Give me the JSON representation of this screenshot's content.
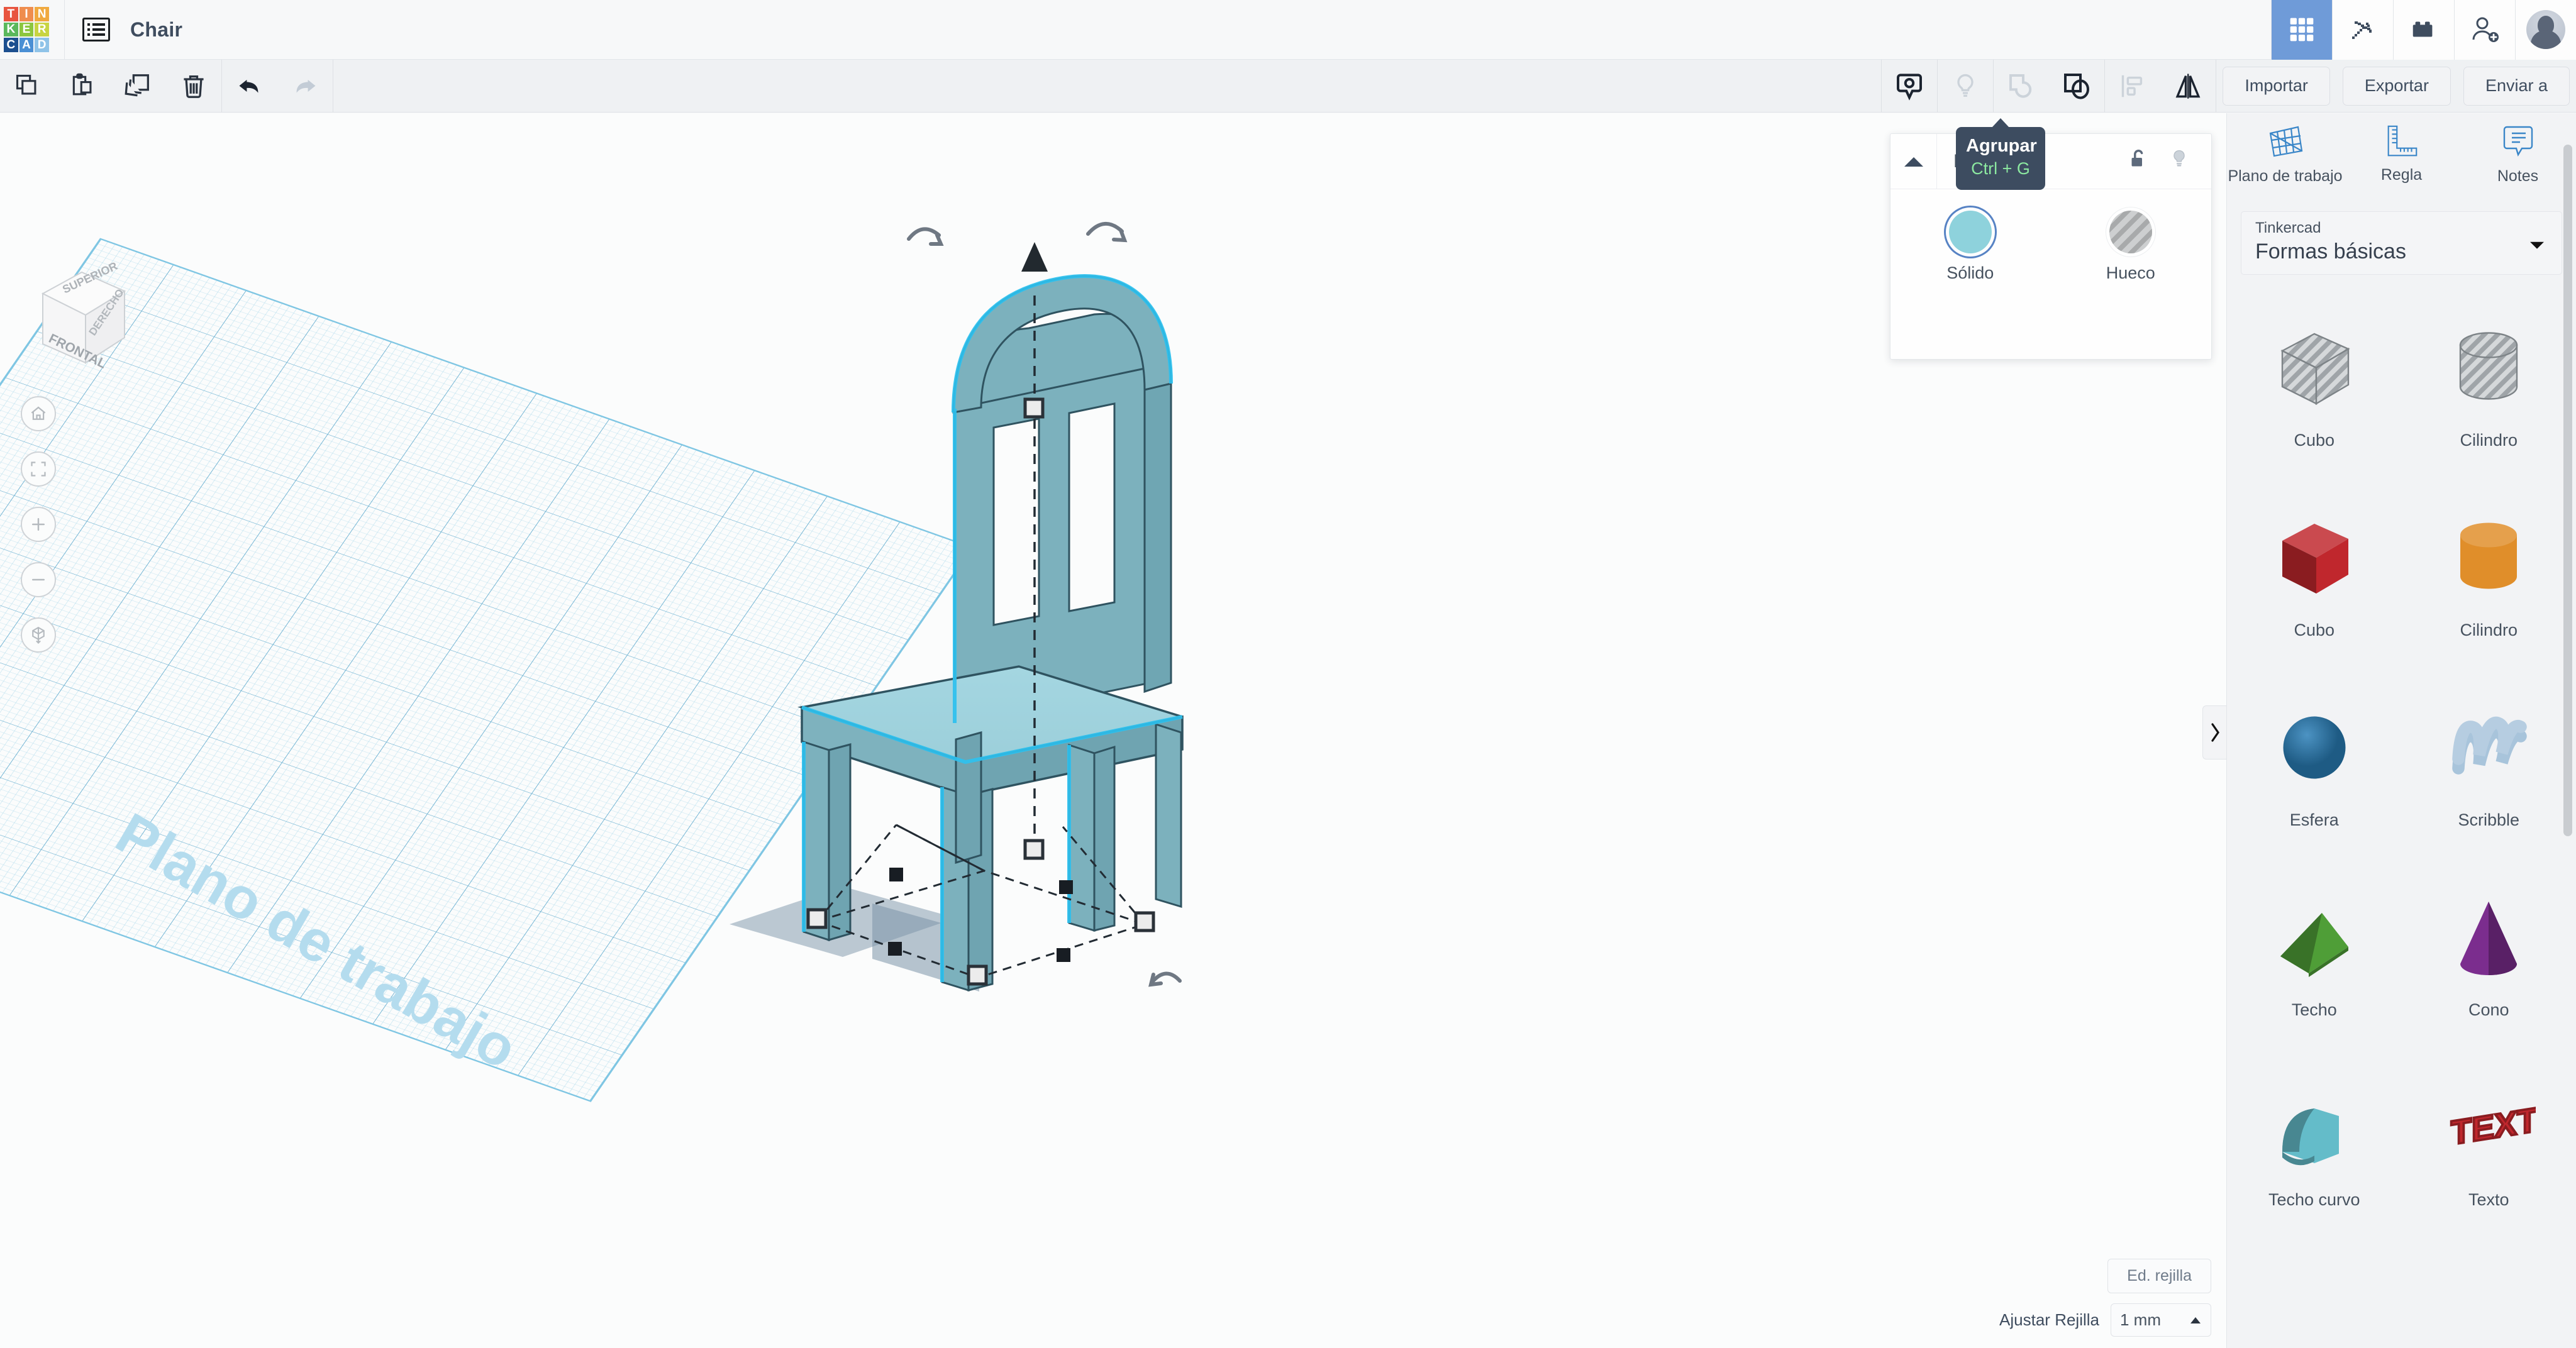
{
  "header": {
    "logo_letters": [
      "T",
      "I",
      "N",
      "K",
      "E",
      "R",
      "C",
      "A",
      "D"
    ],
    "logo_colors": [
      "#e8543f",
      "#ef8d4e",
      "#f0a93f",
      "#5bb85c",
      "#8cc63e",
      "#c8d442",
      "#1c4f8f",
      "#4a8fd4",
      "#8fc3e8"
    ],
    "doc_icon": "document-list-icon",
    "title": "Chair",
    "right_buttons": [
      {
        "name": "grid-apps-icon",
        "label": "Galería",
        "active": true
      },
      {
        "name": "pickaxe-icon",
        "label": "Minecraft",
        "active": false
      },
      {
        "name": "lego-brick-icon",
        "label": "Bloques",
        "active": false
      },
      {
        "name": "add-person-icon",
        "label": "Invitar",
        "active": false
      }
    ],
    "avatar": "user-avatar"
  },
  "toolbar": {
    "left_tools": [
      {
        "name": "copy-icon",
        "label": "Copiar"
      },
      {
        "name": "paste-icon",
        "label": "Pegar"
      },
      {
        "name": "duplicate-icon",
        "label": "Duplicar"
      },
      {
        "name": "delete-icon",
        "label": "Eliminar"
      }
    ],
    "history_tools": [
      {
        "name": "undo-icon",
        "label": "Deshacer",
        "enabled": true
      },
      {
        "name": "redo-icon",
        "label": "Rehacer",
        "enabled": false
      }
    ],
    "right_tools": [
      {
        "name": "note-marker-icon",
        "label": "Nota",
        "enabled": true
      },
      {
        "name": "lightbulb-icon",
        "label": "Luz",
        "enabled": false
      },
      {
        "name": "group-icon",
        "label": "Agrupar",
        "enabled": false
      },
      {
        "name": "ungroup-icon",
        "label": "Desagrupar",
        "enabled": true
      },
      {
        "name": "align-icon",
        "label": "Alinear",
        "enabled": false
      },
      {
        "name": "mirror-icon",
        "label": "Reflejar",
        "enabled": true
      }
    ],
    "import_label": "Importar",
    "export_label": "Exportar",
    "send_to_label": "Enviar a"
  },
  "canvas": {
    "viewcube": {
      "top": "SUPERIOR",
      "front": "FRONTAL",
      "right": "DERECHO"
    },
    "nav_buttons": [
      {
        "name": "home-view-icon",
        "label": "Vista inicial"
      },
      {
        "name": "fit-view-icon",
        "label": "Ajustar a la vista"
      },
      {
        "name": "zoom-in-icon",
        "label": "Acercar"
      },
      {
        "name": "zoom-out-icon",
        "label": "Alejar"
      },
      {
        "name": "perspective-toggle-icon",
        "label": "Perspectiva"
      }
    ],
    "workplane_label": "Plano de trabajo",
    "model_name": "Chair",
    "model_color": "#8fcddb",
    "selection_outline_color": "#2ec1ef",
    "grid_edit_label": "Ed. rejilla",
    "snap_label": "Ajustar Rejilla",
    "snap_value": "1 mm"
  },
  "shape_panel": {
    "title": "Forma",
    "collapse_icon": "triangle-up-icon",
    "lock_icon": "unlock-icon",
    "light_icon": "lightbulb-icon",
    "options": [
      {
        "name": "solid",
        "label": "Sólido",
        "selected": true,
        "color": "#8ed2dc"
      },
      {
        "name": "hole",
        "label": "Hueco",
        "selected": false,
        "color": "#b9bbbd"
      }
    ]
  },
  "tooltip": {
    "title": "Agrupar",
    "shortcut": "Ctrl + G"
  },
  "sidebar": {
    "tools": [
      {
        "name": "workplane-icon",
        "label": "Plano de trabajo"
      },
      {
        "name": "ruler-icon",
        "label": "Regla"
      },
      {
        "name": "notes-icon",
        "label": "Notes"
      }
    ],
    "dropdown": {
      "sublabel": "Tinkercad",
      "value": "Formas básicas"
    },
    "shapes": [
      {
        "label": "Cubo",
        "art": "cube-hollow",
        "color": "#b7bcc0"
      },
      {
        "label": "Cilindro",
        "art": "cylinder-hollow",
        "color": "#b7bcc0"
      },
      {
        "label": "Cubo",
        "art": "cube-solid",
        "color": "#c0272d"
      },
      {
        "label": "Cilindro",
        "art": "cylinder-solid",
        "color": "#e08e2a"
      },
      {
        "label": "Esfera",
        "art": "sphere-solid",
        "color": "#2a7fb8"
      },
      {
        "label": "Scribble",
        "art": "scribble",
        "color": "#a8c4db"
      },
      {
        "label": "Techo",
        "art": "roof-solid",
        "color": "#4f9e37"
      },
      {
        "label": "Cono",
        "art": "cone-solid",
        "color": "#7b2d8e"
      },
      {
        "label": "Techo curvo",
        "art": "curved-roof",
        "color": "#64bcc9"
      },
      {
        "label": "Texto",
        "art": "text-solid",
        "color": "#c0272d"
      }
    ],
    "collapse_icon": "chevron-right-icon"
  }
}
